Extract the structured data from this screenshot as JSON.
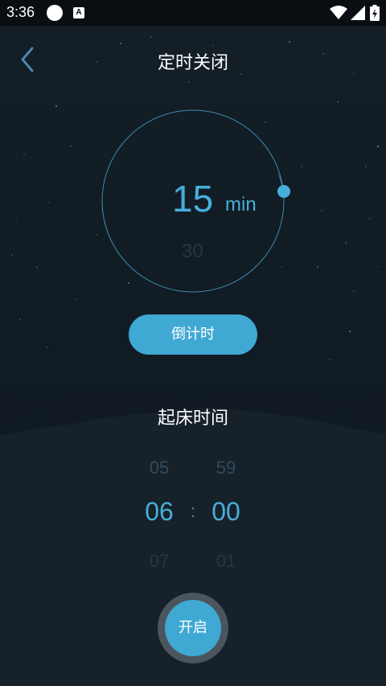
{
  "status_bar": {
    "time": "3:36",
    "notification_letter": "A"
  },
  "header": {
    "title": "定时关闭",
    "back_icon": "chevron-left-icon"
  },
  "timer": {
    "value": "15",
    "unit": "min",
    "next_value": "30",
    "progress_fraction": 0.25
  },
  "countdown_button": {
    "label": "倒计时"
  },
  "wake_time": {
    "title": "起床时间",
    "hours": {
      "prev": "05",
      "selected": "06",
      "next": "07"
    },
    "minutes": {
      "prev": "59",
      "selected": "00",
      "next": "01"
    },
    "separator": ":"
  },
  "start_button": {
    "label": "开启"
  },
  "colors": {
    "accent": "#3fa9d4",
    "background": "#101a22"
  }
}
